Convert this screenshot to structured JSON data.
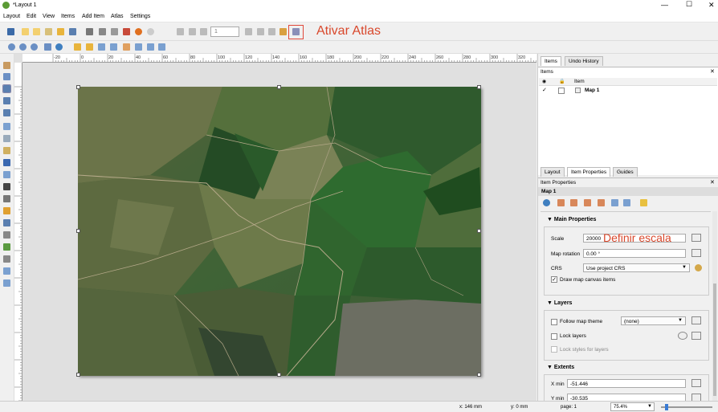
{
  "window": {
    "title": "*Layout 1",
    "controls": [
      "—",
      "☐",
      "✕"
    ]
  },
  "menu": [
    "Layout",
    "Edit",
    "View",
    "Items",
    "Add Item",
    "Atlas",
    "Settings"
  ],
  "toolbar": {
    "atlas_page": "1",
    "annotation_atlas": "Ativar Atlas",
    "atlas_accent": "#e0483a"
  },
  "ruler": {
    "h_ticks": [
      "-20",
      "0",
      "20",
      "40",
      "60",
      "80",
      "100",
      "120",
      "140",
      "160",
      "180",
      "200",
      "220",
      "240",
      "260",
      "280",
      "300",
      "320"
    ],
    "v_ticks": [
      "0",
      "20",
      "40",
      "60",
      "80",
      "100",
      "120",
      "140",
      "160",
      "180",
      "200",
      "220"
    ]
  },
  "right_panel": {
    "top_tabs": [
      "Items",
      "Undo History"
    ],
    "items_header": "Items",
    "items_col": "Item",
    "item_row": "Map 1",
    "mid_tabs": [
      "Layout",
      "Item Properties",
      "Guides"
    ],
    "props_title": "Item Properties",
    "props_item": "Map 1",
    "main_props": "Main Properties",
    "scale_label": "Scale",
    "scale_value": "20000",
    "annotation_scale": "Definir escala",
    "rotation_label": "Map rotation",
    "rotation_value": "0.00 °",
    "crs_label": "CRS",
    "crs_value": "Use project CRS",
    "draw_items_label": "Draw map canvas items",
    "layers_section": "Layers",
    "follow_theme_label": "Follow map theme",
    "follow_theme_value": "(none)",
    "lock_layers_label": "Lock layers",
    "lock_styles_label": "Lock styles for layers",
    "extents_section": "Extents",
    "xmin_label": "X min",
    "xmin_value": "-51.446",
    "ymin_label": "Y min",
    "ymin_value": "-30.535"
  },
  "status": {
    "x": "x: 146 mm",
    "y": "y: 0 mm",
    "page": "page: 1",
    "zoom": "75.4%"
  }
}
